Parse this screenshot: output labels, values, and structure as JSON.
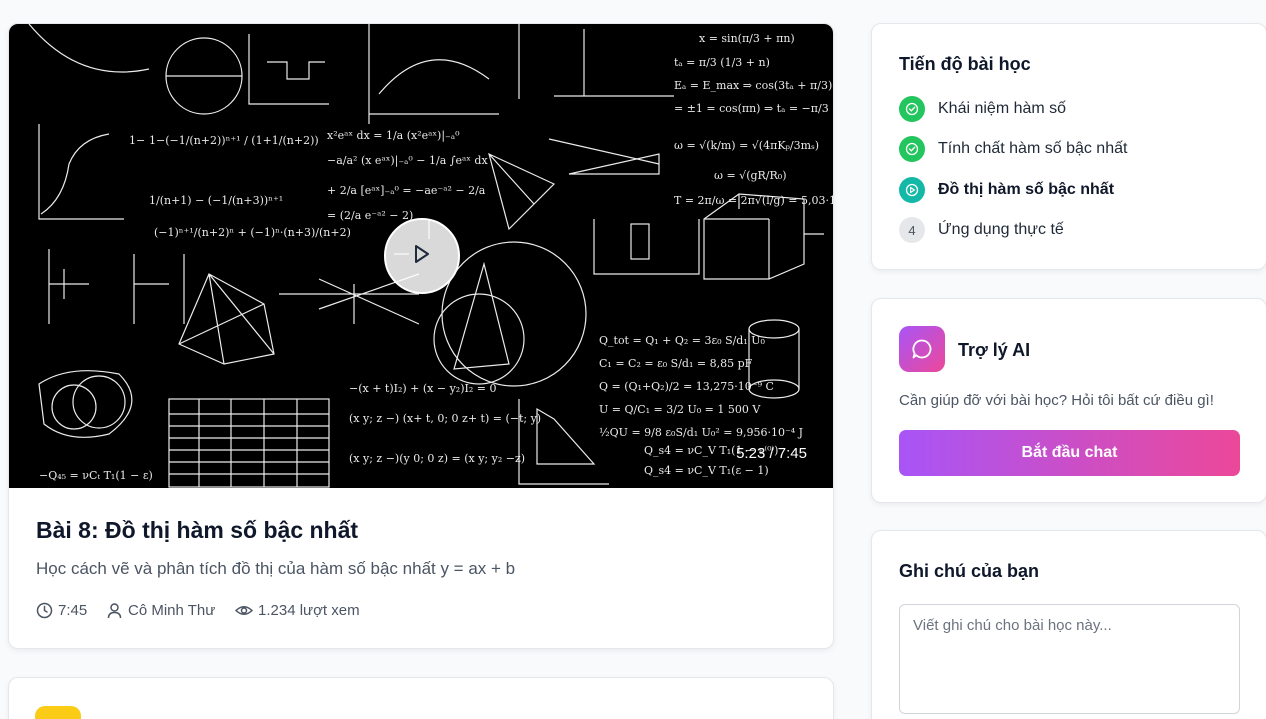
{
  "video": {
    "current_time": "5:23",
    "duration": "7:45",
    "time_display": "5:23 / 7:45",
    "board_formulas": [
      "ω = √(k/m) = √(4πK_p/3m_s)",
      "T = 2π/ω = 2π√(l/g) = 5,03·10⁻⁸s",
      "Q_total = Q₁ + Q₂ = 3ε₀ S/d₁ U₀",
      "C₁ = C₂ = ε₀ S/d₁ = 8,85 pF",
      "Q = (Q₁ + Q₂)/2 = 13,275·10⁻⁹ C",
      "U = Q/C₁ = 3/2 U₀ = 1 500 V",
      "1/2 QU = 9/8 ε₀ S/d₁ U₀² = 9,956·10⁻⁴ J",
      "(−1)ⁿ⁺¹/(n+2)ⁿ + (−1)ⁿ·(n+3)/(n+2)",
      "1−(−1/(n+2))ⁿ⁺¹ / (1+1/(n+2))",
      "∫x² eᵃˣ dx",
      "−(x + t)I₂) + (x − y₂)I₂ = 0",
      "E_a = E_max ⇒ cos(3t_a + π/3) = 1 ⇒ t_a = −π/3",
      "t_b = π/3 (1/3 + n)",
      "x = sin(π/3 + πn)",
      "Q_s4 = νC_V T₁(1 − ε^(0))",
      "Q_s4 = νC_V T₁(ε − 1)"
    ]
  },
  "lesson": {
    "title": "Bài 8: Đồ thị hàm số bậc nhất",
    "description": "Học cách vẽ và phân tích đồ thị của hàm số bậc nhất y = ax + b",
    "duration": "7:45",
    "teacher": "Cô Minh Thư",
    "views": "1.234 lượt xem"
  },
  "progress": {
    "title": "Tiến độ bài học",
    "steps": [
      {
        "label": "Khái niệm hàm số",
        "state": "completed",
        "icon": "check-icon"
      },
      {
        "label": "Tính chất hàm số bậc nhất",
        "state": "completed",
        "icon": "check-icon"
      },
      {
        "label": "Đồ thị hàm số bậc nhất",
        "state": "current",
        "icon": "play-icon"
      },
      {
        "label": "Ứng dụng thực tế",
        "state": "pending",
        "number": "4"
      }
    ]
  },
  "ai": {
    "title": "Trợ lý AI",
    "description": "Cần giúp đỡ với bài học? Hỏi tôi bất cứ điều gì!",
    "button_label": "Bắt đầu chat",
    "icon": "chat-bubble-icon"
  },
  "notes": {
    "title": "Ghi chú của bạn",
    "placeholder": "Viết ghi chú cho bài học này..."
  },
  "colors": {
    "success": "#22c55e",
    "current": "#14b8a6",
    "gradient_start": "#a855f7",
    "gradient_end": "#ec4899",
    "next_card_icon": "#facc15"
  }
}
